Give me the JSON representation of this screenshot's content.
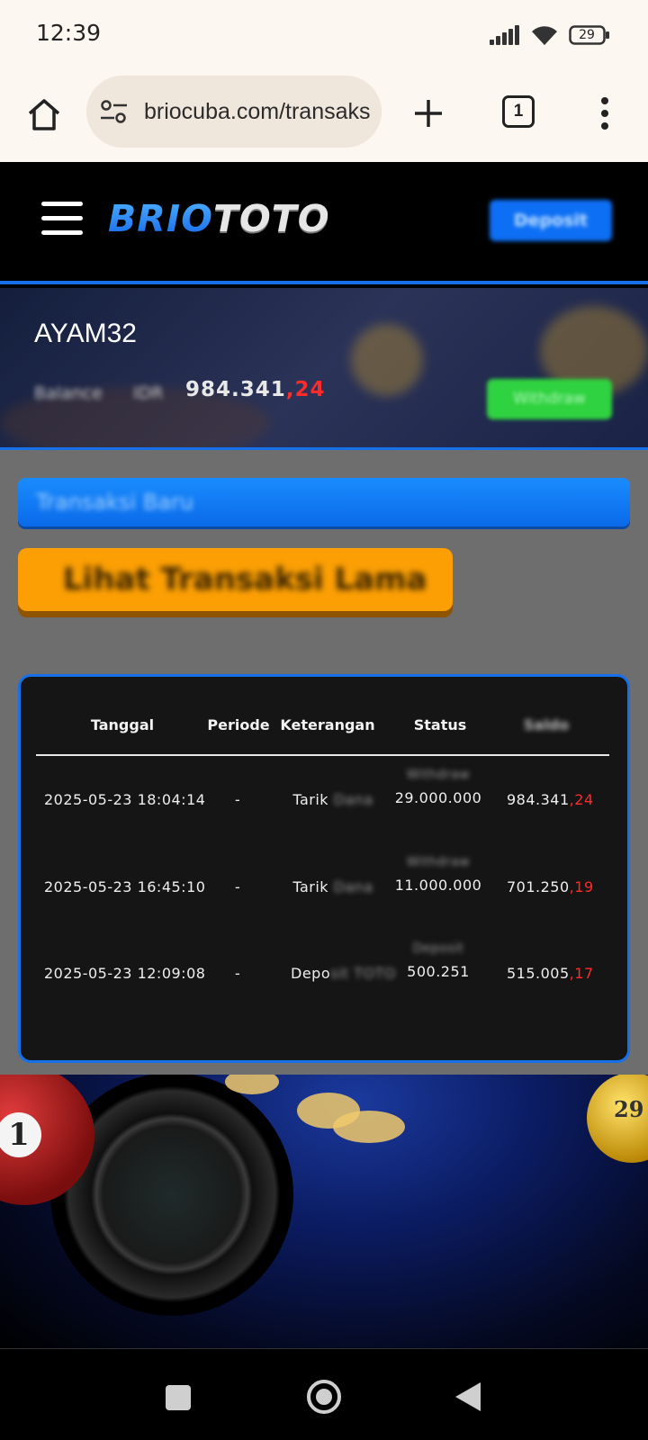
{
  "status_bar": {
    "time": "12:39",
    "battery": "29",
    "icons": [
      "signal-icon",
      "wifi-icon",
      "battery-icon"
    ]
  },
  "browser": {
    "url": "briocuba.com/transaksi",
    "tab_count": "1",
    "icons": [
      "home-icon",
      "site-settings-icon",
      "new-tab-icon",
      "tabs-icon",
      "more-menu-icon"
    ]
  },
  "site_header": {
    "logo_part1": "BRIO",
    "logo_part2": "TOTO",
    "deposit_label": "Deposit",
    "colors": {
      "accent": "#1670e8",
      "deposit_button": "#0d6ff4"
    }
  },
  "user": {
    "username": "AYAM32",
    "balance_label": "Balance",
    "balance_currency": "IDR",
    "balance_amount": "984.341",
    "balance_cents": ",24",
    "withdraw_label": "Withdraw",
    "colors": {
      "withdraw_button": "#2fd240",
      "cents": "#ff2a2a"
    }
  },
  "transactions": {
    "new_tx_label": "Transaksi Baru",
    "old_tx_label": "Lihat Transaksi Lama",
    "headers": {
      "tanggal": "Tanggal",
      "periode": "Periode",
      "keterangan": "Keterangan",
      "status": "Status",
      "saldo": "Saldo"
    },
    "rows": [
      {
        "tanggal": "2025-05-23 18:04:14",
        "periode": "-",
        "keterangan_visible": "Tarik",
        "keterangan_hidden": " Dana",
        "status_label": "Withdraw",
        "status_amount": "29.000.000",
        "saldo": "984.341",
        "saldo_cents": ",24"
      },
      {
        "tanggal": "2025-05-23 16:45:10",
        "periode": "-",
        "keterangan_visible": "Tarik",
        "keterangan_hidden": " Dana",
        "status_label": "Withdraw",
        "status_amount": "11.000.000",
        "saldo": "701.250",
        "saldo_cents": ",19"
      },
      {
        "tanggal": "2025-05-23 12:09:08",
        "periode": "-",
        "keterangan_visible": "Depo",
        "keterangan_hidden": "sit TOTO",
        "status_label": "Deposit",
        "status_amount": "500.251",
        "saldo": "515.005",
        "saldo_cents": ",17"
      }
    ],
    "colors": {
      "table_bg": "#151515",
      "old_tx_button": "#fb9f05",
      "new_tx_bar": "#0a6ae8"
    }
  },
  "banner": {
    "ball_left_number": "1",
    "ball_right_number": "29"
  },
  "nav": {
    "icons": [
      "recents-icon",
      "home-nav-icon",
      "back-icon"
    ]
  }
}
